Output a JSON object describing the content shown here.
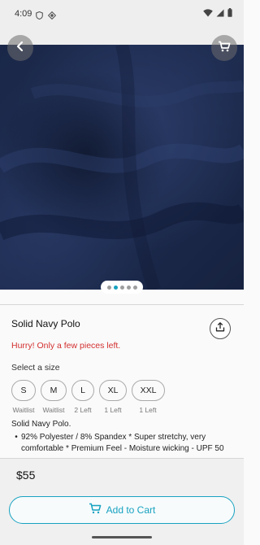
{
  "status_bar": {
    "time": "4:09",
    "icons": [
      "shield-icon",
      "diamond-icon",
      "wifi-icon",
      "signal-icon",
      "battery-icon"
    ]
  },
  "header": {
    "back_icon": "arrow-left-icon",
    "cart_icon": "cart-icon"
  },
  "gallery": {
    "image_description": "navy fabric close-up",
    "page_count": 5,
    "active_page": 2
  },
  "product": {
    "title": "Solid Navy Polo",
    "stock_alert": "Hurry! Only a few pieces left.",
    "size_heading": "Select a size",
    "sizes": [
      {
        "label": "S",
        "availability": "Waitlist"
      },
      {
        "label": "M",
        "availability": "Waitlist"
      },
      {
        "label": "L",
        "availability": "2 Left"
      },
      {
        "label": "XL",
        "availability": "1 Left"
      },
      {
        "label": "XXL",
        "availability": "1 Left"
      }
    ],
    "description_title": "Solid Navy Polo.",
    "description_bullet": "92% Polyester / 8% Spandex * Super stretchy, very comfortable * Premium Feel - Moisture wicking - UPF 50",
    "bullet_mark": "•"
  },
  "purchase": {
    "price": "$55",
    "add_to_cart_label": "Add to Cart"
  },
  "colors": {
    "accent": "#17a2c0",
    "alert": "#d32f2f",
    "fabric": "#1c2a4c"
  }
}
